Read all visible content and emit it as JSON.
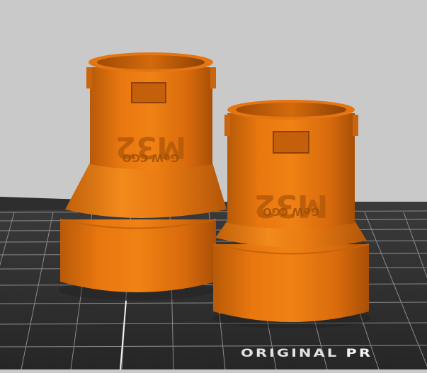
{
  "scene": {
    "background_color": "#c9c9c9",
    "bed_color": "#2b2b2b",
    "grid_color": "#8a8a8a",
    "part_color": "#e0700f",
    "part_shadow_color": "#9a4806"
  },
  "bed": {
    "label_part1": "ORIGINAL",
    "label_part2": "PR"
  },
  "parts": [
    {
      "emboss_main": "M32",
      "emboss_sub": "GeW CGO"
    },
    {
      "emboss_main": "M32",
      "emboss_sub": "GeW CGO"
    }
  ]
}
